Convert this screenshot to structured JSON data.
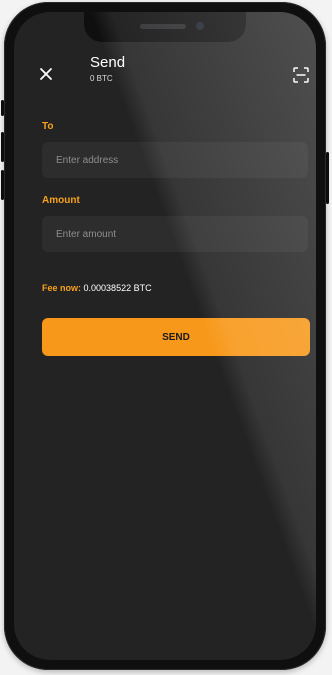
{
  "header": {
    "title": "Send",
    "balance": "0 BTC",
    "close_icon": "close-icon",
    "scan_icon": "qr-scan-icon"
  },
  "form": {
    "to_label": "To",
    "to_placeholder": "Enter address",
    "amount_label": "Amount",
    "amount_placeholder": "Enter amount"
  },
  "fee": {
    "label": "Fee now:",
    "value": "0.00038522 BTC"
  },
  "send_button": {
    "label": "SEND"
  },
  "colors": {
    "accent": "#f7981a",
    "background": "#232324",
    "field": "#2d2d2e"
  }
}
